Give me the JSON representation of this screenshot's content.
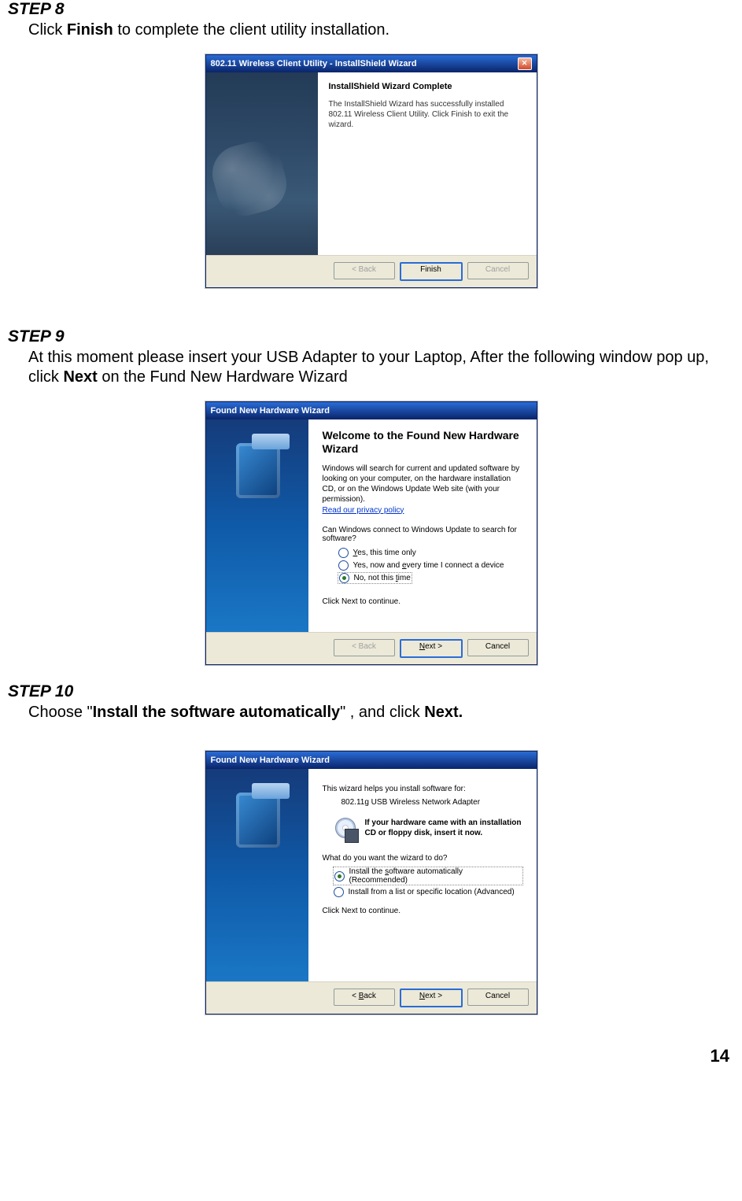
{
  "step8": {
    "heading": "STEP 8",
    "body_prefix": "Click ",
    "body_bold": "Finish",
    "body_suffix": " to complete the client utility installation.",
    "dialog": {
      "title": "802.11 Wireless Client Utility - InstallShield Wizard",
      "close_glyph": "✕",
      "heading": "InstallShield Wizard Complete",
      "text": "The InstallShield Wizard has successfully installed 802.11 Wireless Client Utility. Click Finish to exit the wizard.",
      "back_btn": "< Back",
      "finish_btn": "Finish",
      "cancel_btn": "Cancel"
    }
  },
  "step9": {
    "heading": "STEP 9",
    "body_prefix": "At this moment please insert your USB Adapter to your Laptop, After the following window pop up, click ",
    "body_bold": "Next",
    "body_suffix": " on the Fund New Hardware Wizard",
    "dialog": {
      "title": "Found New Hardware Wizard",
      "heading": "Welcome to the Found New Hardware Wizard",
      "desc": "Windows will search for current and updated software by looking on your computer, on the hardware installation CD, or on the Windows Update Web site (with your permission).",
      "privacy_link": "Read our privacy policy",
      "question": "Can Windows connect to Windows Update to search for software?",
      "opt1": "Yes, this time only",
      "opt2": "Yes, now and every time I connect a device",
      "opt3": "No, not this time",
      "continue": "Click Next to continue.",
      "back_btn": "< Back",
      "next_btn": "Next >",
      "cancel_btn": "Cancel"
    }
  },
  "step10": {
    "heading": "STEP 10",
    "body_prefix": "Choose \"",
    "body_bold": "Install the software automatically",
    "body_mid": "\" , and click ",
    "body_bold2": "Next.",
    "dialog": {
      "title": "Found New Hardware Wizard",
      "helps": "This wizard helps you install software for:",
      "device": "802.11g USB Wireless Network Adapter",
      "hint": "If your hardware came with an installation CD or floppy disk, insert it now.",
      "question": "What do you want the wizard to do?",
      "opt1": "Install the software automatically (Recommended)",
      "opt2": "Install from a list or specific location (Advanced)",
      "continue": "Click Next to continue.",
      "back_btn": "< Back",
      "next_btn": "Next >",
      "cancel_btn": "Cancel"
    }
  },
  "page_number": "14"
}
